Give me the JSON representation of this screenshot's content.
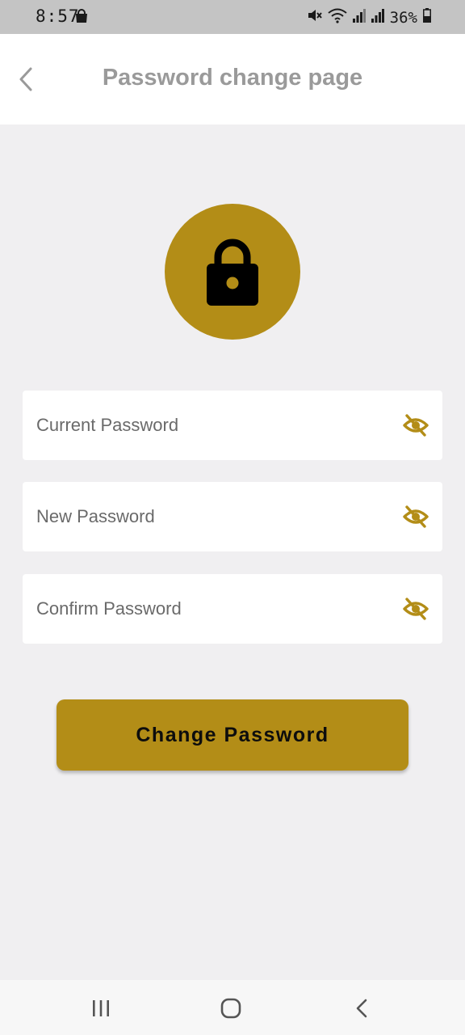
{
  "status_bar": {
    "time": "8:57",
    "battery": "36%"
  },
  "header": {
    "title": "Password change page"
  },
  "form": {
    "current_password": {
      "placeholder": "Current Password",
      "value": ""
    },
    "new_password": {
      "placeholder": "New Password",
      "value": ""
    },
    "confirm_password": {
      "placeholder": "Confirm Password",
      "value": ""
    },
    "submit_label": "Change Password"
  },
  "icons": {
    "back": "chevron-left-icon",
    "lock": "lock-icon",
    "visibility": "eye-off-icon"
  },
  "colors": {
    "accent": "#b38d17",
    "background": "#f0eff1",
    "title_text": "#9a9a9a",
    "status_bar": "#c4c4c4"
  }
}
